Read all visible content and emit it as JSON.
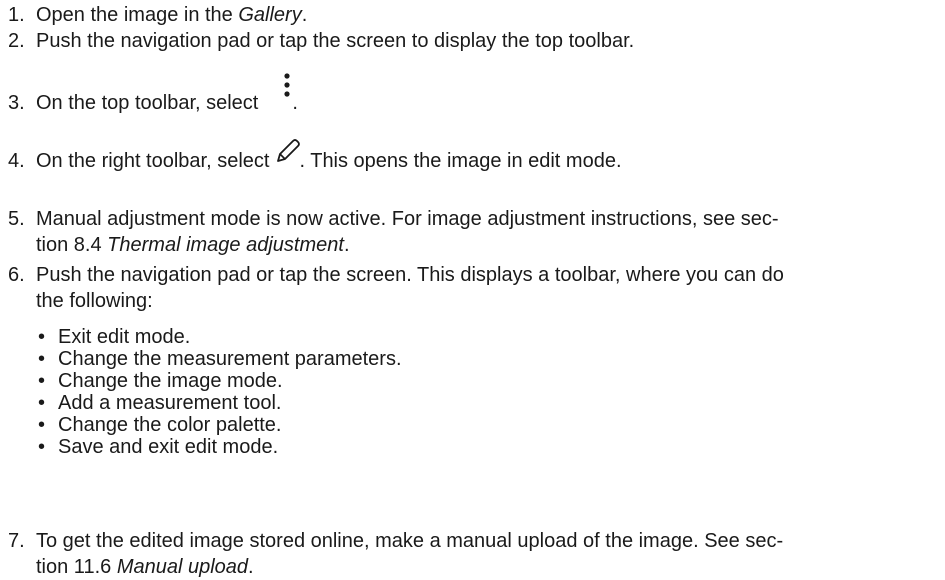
{
  "steps": [
    {
      "number": "1.",
      "prefix": "Open the image in the ",
      "emphasis": "Gallery",
      "suffix": "."
    },
    {
      "number": "2.",
      "text": "Push the navigation pad or tap the screen to display the top toolbar."
    },
    {
      "number": "3.",
      "prefix": "On the top toolbar, select",
      "icon": "more-vertical-icon",
      "suffix": "."
    },
    {
      "number": "4.",
      "prefix": "On the right toolbar, select",
      "icon": "pencil-edit-icon",
      "suffix": ". This opens the image in edit mode."
    },
    {
      "number": "5.",
      "line1": "Manual adjustment mode is now active. For image adjustment instructions, see sec-",
      "line2_prefix": "tion 8.4 ",
      "line2_emphasis": "Thermal image adjustment",
      "line2_suffix": "."
    },
    {
      "number": "6.",
      "line1": "Push the navigation pad or tap the screen. This displays a toolbar, where you can do",
      "line2": "the following:",
      "bullets": [
        "Exit edit mode.",
        "Change the measurement parameters.",
        "Change the image mode.",
        "Add a measurement tool.",
        "Change the color palette.",
        "Save and exit edit mode."
      ]
    },
    {
      "number": "7.",
      "line1": "To get the edited image stored online, make a manual upload of the image. See sec-",
      "line2_prefix": "tion 11.6 ",
      "line2_emphasis": "Manual upload",
      "line2_suffix": "."
    }
  ]
}
